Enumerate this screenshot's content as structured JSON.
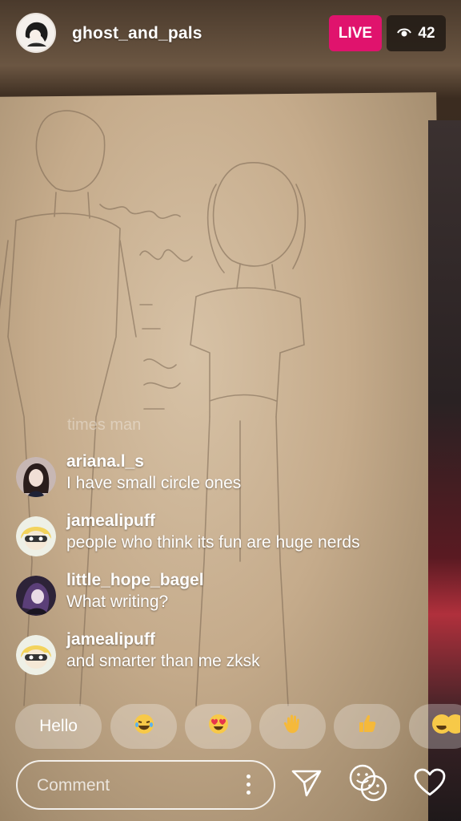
{
  "header": {
    "host_username": "ghost_and_pals",
    "live_label": "LIVE",
    "viewer_count": "42",
    "live_color": "#e0136d"
  },
  "overlay": {
    "faded_comment": "times man"
  },
  "comments": [
    {
      "username": "ariana.l_s",
      "text": "I have small circle ones",
      "avatar": "avatar-anime-girl-dark-hair"
    },
    {
      "username": "jamealipuff",
      "text": "people who think its fun are huge nerds",
      "avatar": "avatar-inkling-yellow"
    },
    {
      "username": "little_hope_bagel",
      "text": "What writing?",
      "avatar": "avatar-purple-character"
    },
    {
      "username": "jamealipuff",
      "text": "and smarter than me zksk",
      "avatar": "avatar-inkling-yellow"
    }
  ],
  "quick_reactions": {
    "hello_label": "Hello",
    "emojis": [
      "laughing-tears-emoji",
      "heart-eyes-emoji",
      "waving-hand-emoji",
      "thumbs-up-emoji",
      "laughing-tears-emoji"
    ]
  },
  "composer": {
    "placeholder": "Comment"
  },
  "icons": {
    "send": "send-icon",
    "faces": "face-filter-icon",
    "like": "heart-icon",
    "more": "more-vertical-icon",
    "viewers": "eye-icon"
  }
}
